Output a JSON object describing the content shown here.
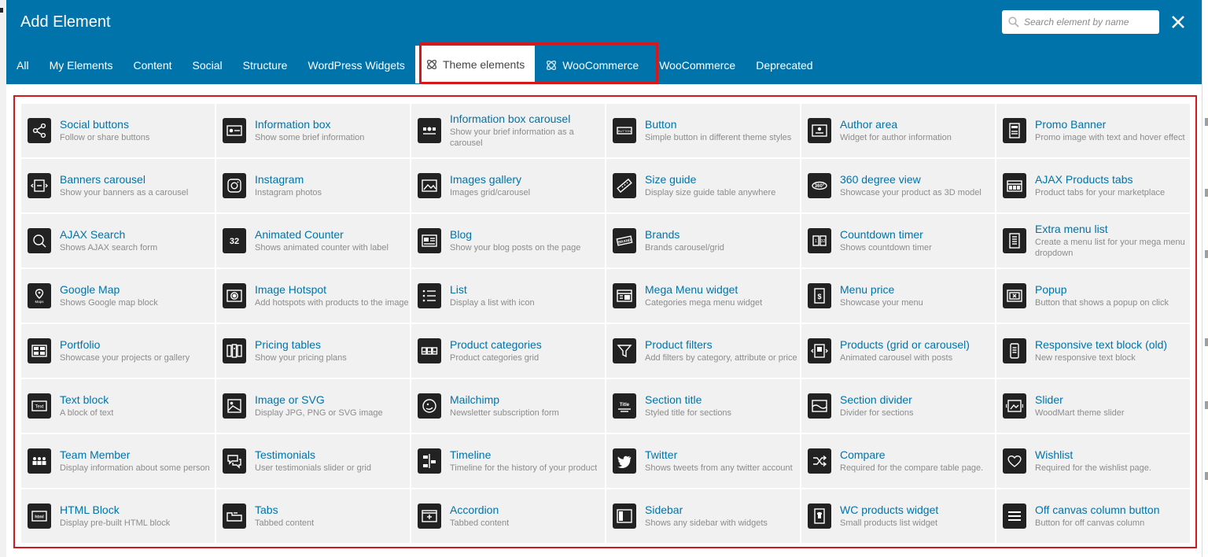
{
  "modal": {
    "title": "Add Element",
    "search": {
      "placeholder": "Search element by name",
      "value": ""
    },
    "close_label": "×"
  },
  "tabs": [
    {
      "label": "All"
    },
    {
      "label": "My Elements"
    },
    {
      "label": "Content"
    },
    {
      "label": "Social"
    },
    {
      "label": "Structure"
    },
    {
      "label": "WordPress Widgets"
    },
    {
      "label": "Theme elements",
      "icon": "woodmart-logo-icon",
      "active": true
    },
    {
      "label": "WooCommerce",
      "icon": "woodmart-logo-icon"
    },
    {
      "label": "WooCommerce"
    },
    {
      "label": "Deprecated"
    }
  ],
  "elements": [
    {
      "name": "Social buttons",
      "desc": "Follow or share buttons",
      "icon": "share-icon"
    },
    {
      "name": "Information box",
      "desc": "Show some brief information",
      "icon": "info-box-icon"
    },
    {
      "name": "Information box carousel",
      "desc": "Show your brief information as a carousel",
      "icon": "info-carousel-icon"
    },
    {
      "name": "Button",
      "desc": "Simple button in different theme styles",
      "icon": "button-icon"
    },
    {
      "name": "Author area",
      "desc": "Widget for author information",
      "icon": "author-icon"
    },
    {
      "name": "Promo Banner",
      "desc": "Promo image with text and hover effect",
      "icon": "promo-banner-icon"
    },
    {
      "name": "Banners carousel",
      "desc": "Show your banners as a carousel",
      "icon": "banners-carousel-icon"
    },
    {
      "name": "Instagram",
      "desc": "Instagram photos",
      "icon": "instagram-icon"
    },
    {
      "name": "Images gallery",
      "desc": "Images grid/carousel",
      "icon": "gallery-icon"
    },
    {
      "name": "Size guide",
      "desc": "Display size guide table anywhere",
      "icon": "ruler-icon"
    },
    {
      "name": "360 degree view",
      "desc": "Showcase your product as 3D model",
      "icon": "360-icon"
    },
    {
      "name": "AJAX Products tabs",
      "desc": "Product tabs for your marketplace",
      "icon": "product-tabs-icon"
    },
    {
      "name": "AJAX Search",
      "desc": "Shows AJAX search form",
      "icon": "search-icon"
    },
    {
      "name": "Animated Counter",
      "desc": "Shows animated counter with label",
      "icon": "counter-icon"
    },
    {
      "name": "Blog",
      "desc": "Show your blog posts on the page",
      "icon": "blog-icon"
    },
    {
      "name": "Brands",
      "desc": "Brands carousel/grid",
      "icon": "brands-icon"
    },
    {
      "name": "Countdown timer",
      "desc": "Shows countdown timer",
      "icon": "countdown-icon"
    },
    {
      "name": "Extra menu list",
      "desc": "Create a menu list for your mega menu dropdown",
      "icon": "extra-menu-icon"
    },
    {
      "name": "Google Map",
      "desc": "Shows Google map block",
      "icon": "map-icon"
    },
    {
      "name": "Image Hotspot",
      "desc": "Add hotspots with products to the image",
      "icon": "hotspot-icon"
    },
    {
      "name": "List",
      "desc": "Display a list with icon",
      "icon": "list-icon"
    },
    {
      "name": "Mega Menu widget",
      "desc": "Categories mega menu widget",
      "icon": "mega-menu-icon"
    },
    {
      "name": "Menu price",
      "desc": "Showcase your menu",
      "icon": "menu-price-icon"
    },
    {
      "name": "Popup",
      "desc": "Button that shows a popup on click",
      "icon": "popup-icon"
    },
    {
      "name": "Portfolio",
      "desc": "Showcase your projects or gallery",
      "icon": "portfolio-icon"
    },
    {
      "name": "Pricing tables",
      "desc": "Show your pricing plans",
      "icon": "pricing-icon"
    },
    {
      "name": "Product categories",
      "desc": "Product categories grid",
      "icon": "categories-icon"
    },
    {
      "name": "Product filters",
      "desc": "Add filters by category, attribute or price",
      "icon": "filter-icon"
    },
    {
      "name": "Products (grid or carousel)",
      "desc": "Animated carousel with posts",
      "icon": "products-icon"
    },
    {
      "name": "Responsive text block (old)",
      "desc": "New responsive text block",
      "icon": "responsive-text-icon"
    },
    {
      "name": "Text block",
      "desc": "A block of text",
      "icon": "text-block-icon"
    },
    {
      "name": "Image or SVG",
      "desc": "Display JPG, PNG or SVG image",
      "icon": "image-icon"
    },
    {
      "name": "Mailchimp",
      "desc": "Newsletter subscription form",
      "icon": "mailchimp-icon"
    },
    {
      "name": "Section title",
      "desc": "Styled title for sections",
      "icon": "section-title-icon"
    },
    {
      "name": "Section divider",
      "desc": "Divider for sections",
      "icon": "divider-icon"
    },
    {
      "name": "Slider",
      "desc": "WoodMart theme slider",
      "icon": "slider-icon"
    },
    {
      "name": "Team Member",
      "desc": "Display information about some person",
      "icon": "team-icon"
    },
    {
      "name": "Testimonials",
      "desc": "User testimonials slider or grid",
      "icon": "testimonials-icon"
    },
    {
      "name": "Timeline",
      "desc": "Timeline for the history of your product",
      "icon": "timeline-icon"
    },
    {
      "name": "Twitter",
      "desc": "Shows tweets from any twitter account",
      "icon": "twitter-icon"
    },
    {
      "name": "Compare",
      "desc": "Required for the compare table page.",
      "icon": "compare-icon"
    },
    {
      "name": "Wishlist",
      "desc": "Required for the wishlist page.",
      "icon": "heart-icon"
    },
    {
      "name": "HTML Block",
      "desc": "Display pre-built HTML block",
      "icon": "html-icon"
    },
    {
      "name": "Tabs",
      "desc": "Tabbed content",
      "icon": "tabs-icon"
    },
    {
      "name": "Accordion",
      "desc": "Tabbed content",
      "icon": "accordion-icon"
    },
    {
      "name": "Sidebar",
      "desc": "Shows any sidebar with widgets",
      "icon": "sidebar-icon"
    },
    {
      "name": "WC products widget",
      "desc": "Small products list widget",
      "icon": "wc-products-icon"
    },
    {
      "name": "Off canvas column button",
      "desc": "Button for off canvas column",
      "icon": "hamburger-icon"
    }
  ],
  "colors": {
    "header": "#0073aa",
    "highlight": "#d6171c",
    "link": "#0073aa",
    "tile": "#f1f1f1"
  }
}
